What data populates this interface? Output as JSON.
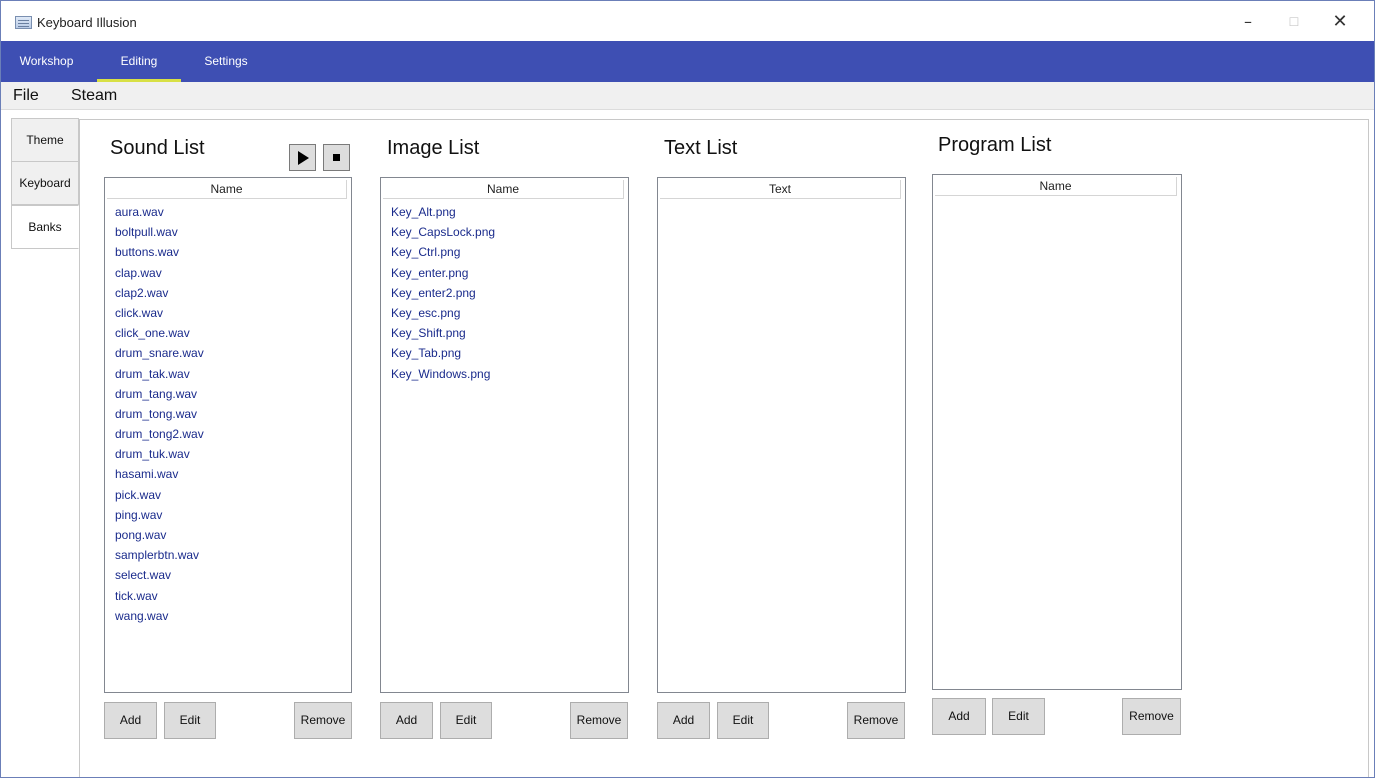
{
  "window": {
    "title": "Keyboard Illusion",
    "minimize_glyph": "–",
    "maximize_glyph": "☐",
    "close_glyph": "✕"
  },
  "nav": {
    "tabs": [
      {
        "label": "Workshop"
      },
      {
        "label": "Editing",
        "active": true
      },
      {
        "label": "Settings"
      }
    ],
    "bar_color": "#3e4fb3",
    "active_underline_color": "#d8e045"
  },
  "menu": {
    "items": [
      {
        "label": "File"
      },
      {
        "label": "Steam"
      }
    ]
  },
  "side_tabs": [
    {
      "label": "Theme"
    },
    {
      "label": "Keyboard"
    },
    {
      "label": "Banks",
      "selected": true
    }
  ],
  "sound_list": {
    "title": "Sound List",
    "column": "Name",
    "items": [
      "aura.wav",
      "boltpull.wav",
      "buttons.wav",
      "clap.wav",
      "clap2.wav",
      "click.wav",
      "click_one.wav",
      "drum_snare.wav",
      "drum_tak.wav",
      "drum_tang.wav",
      "drum_tong.wav",
      "drum_tong2.wav",
      "drum_tuk.wav",
      "hasami.wav",
      "pick.wav",
      "ping.wav",
      "pong.wav",
      "samplerbtn.wav",
      "select.wav",
      "tick.wav",
      "wang.wav"
    ],
    "add_label": "Add",
    "edit_label": "Edit",
    "remove_label": "Remove"
  },
  "image_list": {
    "title": "Image List",
    "column": "Name",
    "items": [
      "Key_Alt.png",
      "Key_CapsLock.png",
      "Key_Ctrl.png",
      "Key_enter.png",
      "Key_enter2.png",
      "Key_esc.png",
      "Key_Shift.png",
      "Key_Tab.png",
      "Key_Windows.png"
    ],
    "add_label": "Add",
    "edit_label": "Edit",
    "remove_label": "Remove"
  },
  "text_list": {
    "title": "Text List",
    "column": "Text",
    "items": [],
    "add_label": "Add",
    "edit_label": "Edit",
    "remove_label": "Remove"
  },
  "program_list": {
    "title": "Program List",
    "column": "Name",
    "items": [],
    "add_label": "Add",
    "edit_label": "Edit",
    "remove_label": "Remove"
  },
  "item_text_color": "#1a2b8c"
}
